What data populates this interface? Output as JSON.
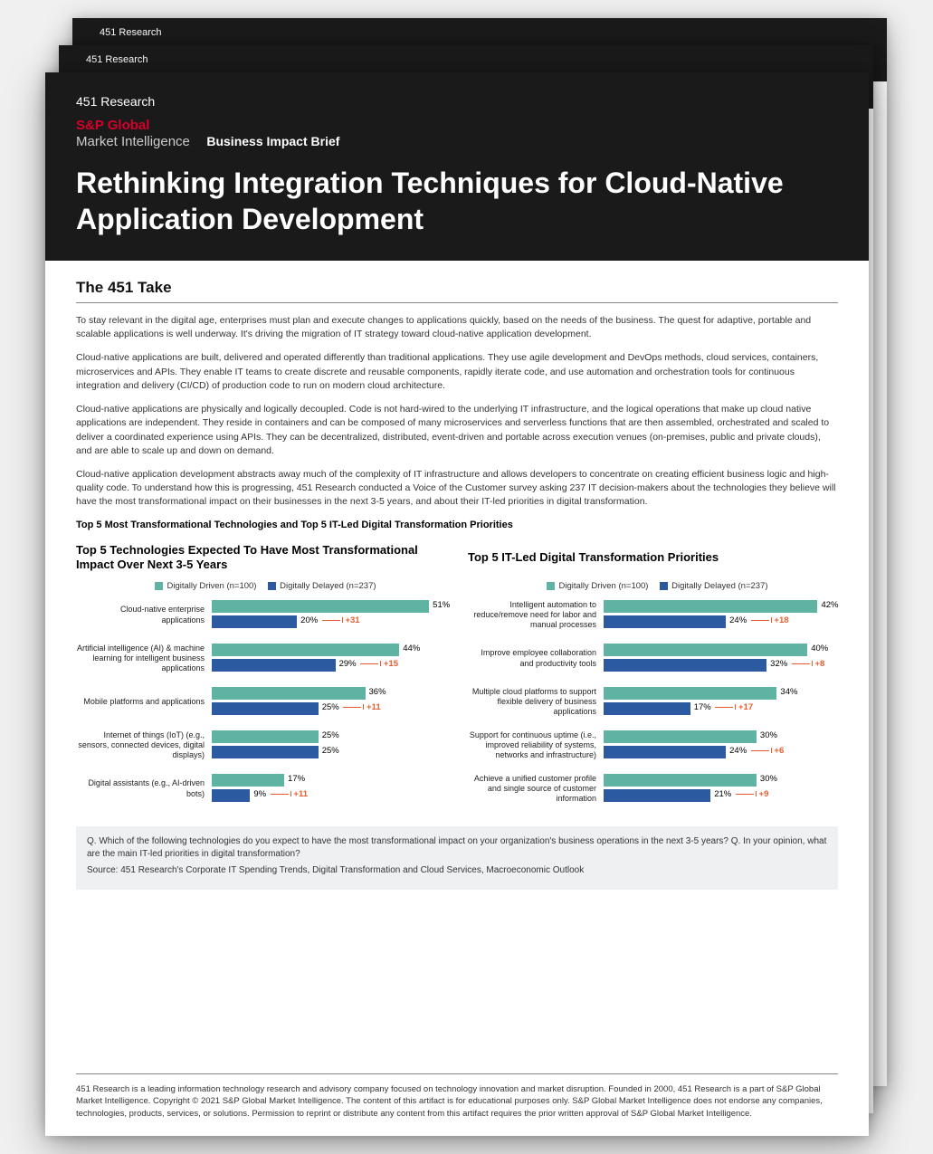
{
  "brand": {
    "r451": "451 Research",
    "spg": "S&P Global",
    "mi": "Market Intelligence",
    "brief": "Business Impact Brief"
  },
  "title": "Rethinking Integration Techniques for Cloud-Native Application Development",
  "take_heading": "The 451 Take",
  "paragraphs": {
    "p1": "To stay relevant in the digital age, enterprises must plan and execute changes to applications quickly, based on the needs of the business. The quest for adaptive, portable and scalable applications is well underway. It's driving the migration of IT strategy toward cloud-native application development.",
    "p2": "Cloud-native applications are built, delivered and operated differently than traditional applications. They use agile development and DevOps methods, cloud services, containers, microservices and APIs. They enable IT teams to create discrete and reusable components, rapidly iterate code, and use automation and orchestration tools for continuous integration and delivery (CI/CD) of production code to run on modern cloud architecture.",
    "p3": "Cloud-native applications are physically and logically decoupled. Code is not hard-wired to the underlying IT infrastructure, and the logical operations that make up cloud native applications are independent. They reside in containers and can be composed of many microservices and serverless functions that are then assembled, orchestrated and scaled to deliver a coordinated experience using APIs. They can be decentralized, distributed, event-driven and portable across execution venues (on-premises, public and private clouds), and are able to scale up and down on demand.",
    "p4": "Cloud-native application development abstracts away much of the complexity of IT infrastructure and allows developers to concentrate on creating efficient business logic and high-quality code. To understand how this is progressing, 451 Research conducted a Voice of the Customer survey asking 237 IT decision-makers about the technologies they believe will have the most transformational impact on their businesses in the next 3-5 years, and about their IT-led priorities in digital transformation."
  },
  "section_label": "Top 5 Most Transformational Technologies and Top 5 IT-Led Digital Transformation Priorities",
  "legend": {
    "driven": "Digitally Driven (n=100)",
    "delayed": "Digitally Delayed (n=237)"
  },
  "chart_data": [
    {
      "type": "bar",
      "title": "Top 5 Technologies Expected To Have Most Transformational Impact Over Next 3-5 Years",
      "series_names": [
        "Digitally Driven (n=100)",
        "Digitally Delayed (n=237)"
      ],
      "max": 55,
      "items": [
        {
          "label": "Cloud-native enterprise applications",
          "driven": 51,
          "delayed": 20,
          "diff": "+31"
        },
        {
          "label": "Artificial intelligence (AI) & machine learning for intelligent business applications",
          "driven": 44,
          "delayed": 29,
          "diff": "+15"
        },
        {
          "label": "Mobile platforms and applications",
          "driven": 36,
          "delayed": 25,
          "diff": "+11"
        },
        {
          "label": "Internet of things (IoT) (e.g., sensors, connected devices, digital displays)",
          "driven": 25,
          "delayed": 25,
          "diff": ""
        },
        {
          "label": "Digital assistants (e.g., AI-driven bots)",
          "driven": 17,
          "delayed": 9,
          "diff": "+11"
        }
      ]
    },
    {
      "type": "bar",
      "title": "Top 5 IT-Led Digital Transformation Priorities",
      "series_names": [
        "Digitally Driven (n=100)",
        "Digitally Delayed (n=237)"
      ],
      "max": 46,
      "items": [
        {
          "label": "Intelligent automation to reduce/remove need for labor and manual processes",
          "driven": 42,
          "delayed": 24,
          "diff": "+18"
        },
        {
          "label": "Improve employee collaboration and productivity tools",
          "driven": 40,
          "delayed": 32,
          "diff": "+8"
        },
        {
          "label": "Multiple cloud platforms to support flexible delivery of business applications",
          "driven": 34,
          "delayed": 17,
          "diff": "+17"
        },
        {
          "label": "Support for continuous uptime (i.e., improved reliability of systems, networks and infrastructure)",
          "driven": 30,
          "delayed": 24,
          "diff": "+6"
        },
        {
          "label": "Achieve a unified customer profile and single source of customer information",
          "driven": 30,
          "delayed": 21,
          "diff": "+9"
        }
      ]
    }
  ],
  "question_box": {
    "q": "Q. Which of the following technologies do you expect to have the most transformational impact on your organization's business operations in the next 3-5 years? Q. In your opinion, what are the main IT-led priorities in digital transformation?",
    "source": "Source: 451 Research's Corporate IT Spending Trends, Digital Transformation and Cloud Services, Macroeconomic Outlook"
  },
  "footer": "451 Research is a leading information technology research and advisory company focused on technology innovation and market disruption. Founded in 2000, 451 Research is a part of S&P Global Market Intelligence. Copyright © 2021 S&P Global Market Intelligence. The content of this artifact is for educational purposes only. S&P Global Market Intelligence does not endorse any companies, technologies, products, services, or solutions. Permission to reprint or distribute any content from this artifact requires the prior written approval of S&P Global Market Intelligence."
}
